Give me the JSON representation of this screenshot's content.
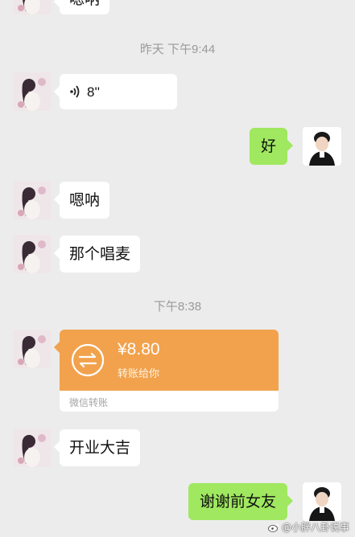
{
  "messages": {
    "m0": "嗯呐",
    "voice_duration": "8''",
    "m2": "好",
    "m3": "嗯呐",
    "m4": "那个唱麦",
    "m5": "开业大吉",
    "m6": "谢谢前女友"
  },
  "timestamps": {
    "t1": "昨天 下午9:44",
    "t2": "下午8:38"
  },
  "transfer": {
    "amount": "¥8.80",
    "description": "转账给你",
    "footer": "微信转账"
  },
  "watermark": "@小胖八卦说事",
  "icons": {
    "voice": "voice-wave-icon",
    "transfer": "transfer-arrows-icon",
    "watermark_logo": "weibo-logo-icon"
  },
  "colors": {
    "background": "#ececec",
    "incoming_bubble": "#ffffff",
    "outgoing_bubble": "#9fe85f",
    "transfer_card": "#f2a24c"
  }
}
